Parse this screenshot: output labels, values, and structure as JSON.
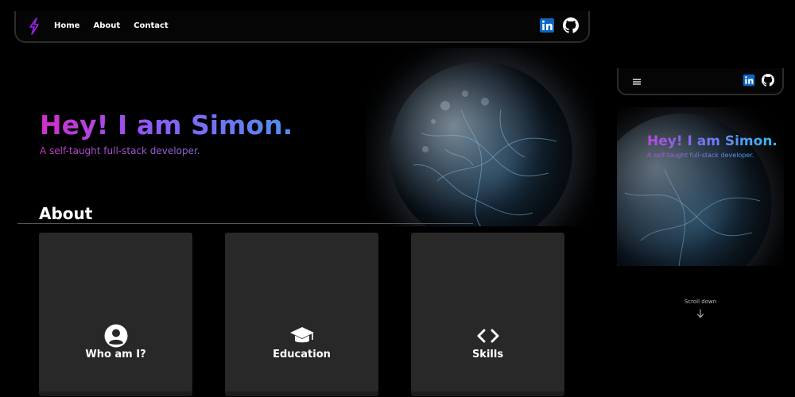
{
  "nav": {
    "links": [
      "Home",
      "About",
      "Contact"
    ]
  },
  "hero": {
    "title": "Hey! I am Simon.",
    "subtitle": "A self-taught full-stack developer."
  },
  "about": {
    "heading": "About",
    "cards": [
      {
        "label": "Who am I?",
        "icon": "user-circle-icon"
      },
      {
        "label": "Education",
        "icon": "graduation-cap-icon"
      },
      {
        "label": "Skills",
        "icon": "code-icon"
      }
    ]
  },
  "mobile": {
    "title": "Hey! I am Simon.",
    "subtitle": "A self-taught full-stack developer.",
    "scroll_hint": "Scroll down"
  },
  "social": {
    "icons": [
      "linkedin-icon",
      "github-icon"
    ]
  },
  "colors": {
    "background": "#000000",
    "card": "#282828",
    "gradient_start": "#d12fc9",
    "gradient_end": "#4f8ff0",
    "linkedin": "#0a66c2",
    "logo": "#a020f0"
  }
}
